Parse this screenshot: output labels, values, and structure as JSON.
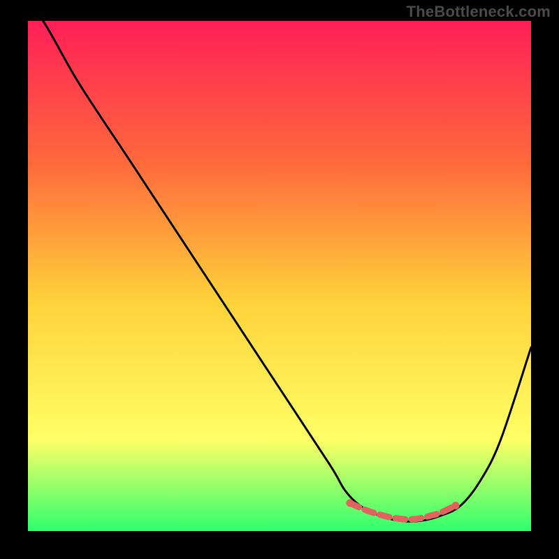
{
  "watermark": "TheBottleneck.com",
  "colors": {
    "frame": "#000000",
    "gradient_top": "#ff1f57",
    "gradient_mid1": "#ff6a3c",
    "gradient_mid2": "#ffd23a",
    "gradient_mid3": "#ffff66",
    "gradient_bottom": "#2fff6e",
    "curve": "#000000",
    "marker": "#e0635f"
  },
  "chart_data": {
    "type": "line",
    "title": "",
    "xlabel": "",
    "ylabel": "",
    "xlim": [
      0,
      100
    ],
    "ylim": [
      0,
      100
    ],
    "series": [
      {
        "name": "bottleneck-curve",
        "x": [
          0,
          3,
          10,
          20,
          30,
          40,
          50,
          60,
          63,
          66,
          70,
          74,
          78,
          82,
          86,
          90,
          94,
          100
        ],
        "y": [
          102,
          100,
          88,
          73,
          58,
          43,
          28,
          13,
          8,
          5,
          3,
          2,
          2,
          3,
          5,
          10,
          18,
          36
        ]
      }
    ],
    "markers": {
      "name": "highlight-band",
      "x": [
        64,
        66,
        68,
        70,
        72,
        74,
        76,
        78,
        80,
        82,
        85
      ],
      "y": [
        5.5,
        4.6,
        3.8,
        3.2,
        2.7,
        2.4,
        2.3,
        2.5,
        3.0,
        3.6,
        5.0
      ]
    }
  }
}
